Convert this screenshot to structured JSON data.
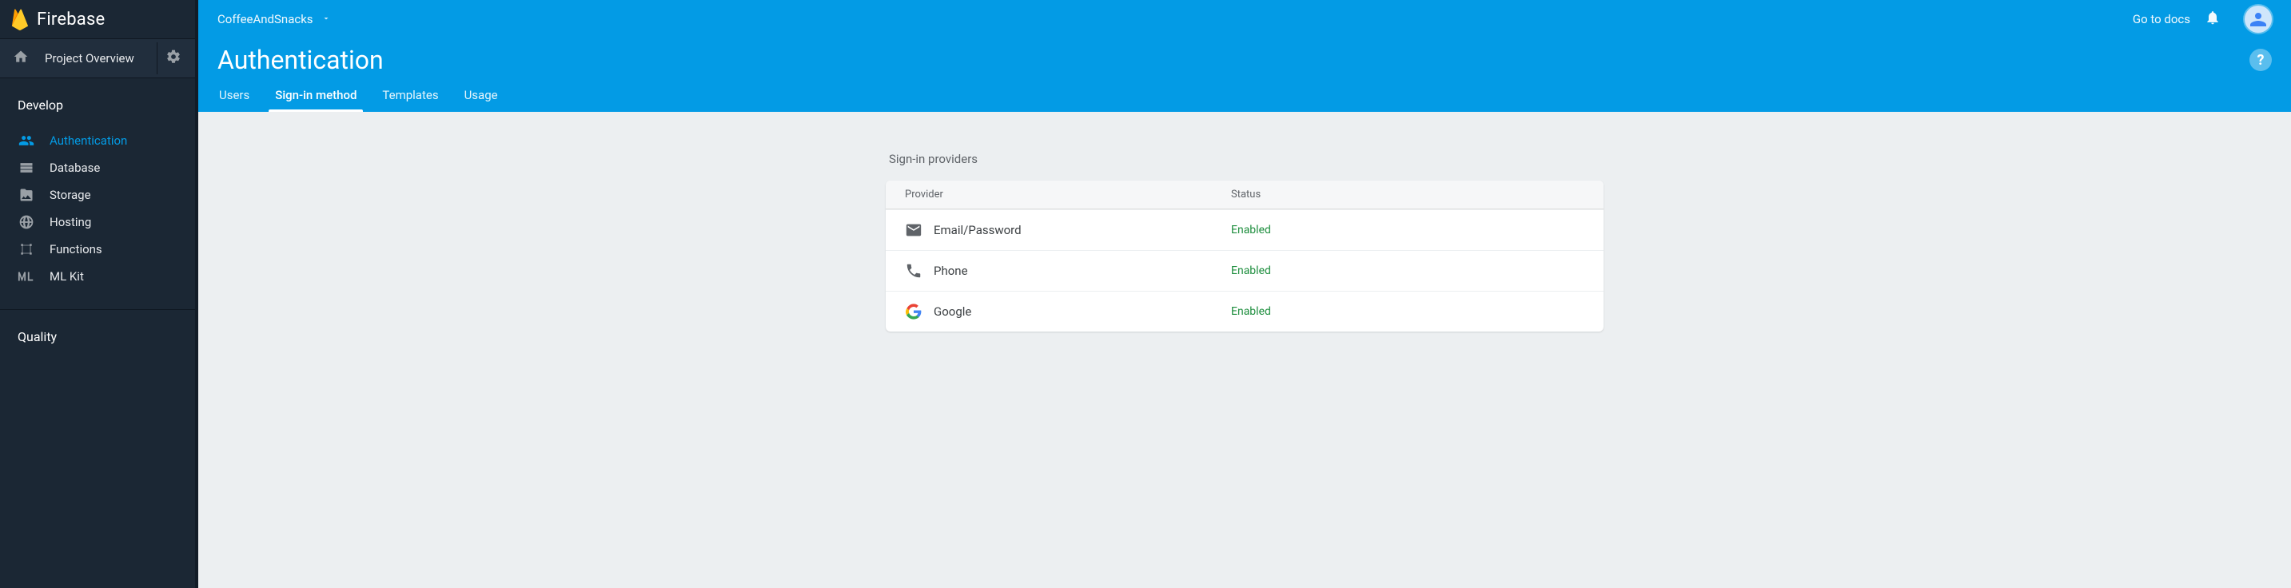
{
  "brand": "Firebase",
  "overview": {
    "label": "Project Overview"
  },
  "sections": [
    {
      "title": "Develop",
      "items": [
        {
          "id": "authentication",
          "label": "Authentication",
          "icon": "people-icon",
          "active": true
        },
        {
          "id": "database",
          "label": "Database",
          "icon": "db-icon"
        },
        {
          "id": "storage",
          "label": "Storage",
          "icon": "folder-icon"
        },
        {
          "id": "hosting",
          "label": "Hosting",
          "icon": "globe-icon"
        },
        {
          "id": "functions",
          "label": "Functions",
          "icon": "fn-icon"
        },
        {
          "id": "mlkit",
          "label": "ML Kit",
          "icon": "ml-icon"
        }
      ]
    },
    {
      "title": "Quality",
      "items": []
    }
  ],
  "project": {
    "name": "CoffeeAndSnacks"
  },
  "docs_link": "Go to docs",
  "page_title": "Authentication",
  "tabs": [
    {
      "label": "Users"
    },
    {
      "label": "Sign-in method",
      "active": true
    },
    {
      "label": "Templates"
    },
    {
      "label": "Usage"
    }
  ],
  "sign_in": {
    "section_title": "Sign-in providers",
    "columns": {
      "provider": "Provider",
      "status": "Status"
    },
    "providers": [
      {
        "name": "Email/Password",
        "icon": "mail-icon",
        "status": "Enabled"
      },
      {
        "name": "Phone",
        "icon": "phone-icon",
        "status": "Enabled"
      },
      {
        "name": "Google",
        "icon": "google-icon",
        "status": "Enabled"
      }
    ]
  }
}
